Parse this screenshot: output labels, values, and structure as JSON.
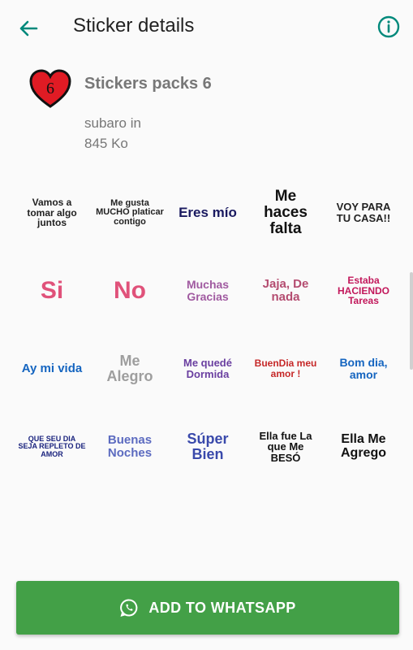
{
  "header": {
    "title": "Sticker details",
    "back_icon": "arrow-back-icon",
    "info_icon": "info-icon",
    "accent_color": "#00897b"
  },
  "pack": {
    "name": "Stickers packs 6",
    "author": "subaro in",
    "size": "845 Ko",
    "icon": "heart-number-icon",
    "icon_number": "6"
  },
  "stickers": [
    {
      "text": "Vamos a tomar algo juntos",
      "color": "#222222",
      "size": 12
    },
    {
      "text": "Me gusta MUCHO platicar contigo",
      "color": "#222222",
      "size": 11
    },
    {
      "text": "Eres mío",
      "color": "#1a1a60",
      "size": 17
    },
    {
      "text": "Me haces falta",
      "color": "#111111",
      "size": 19
    },
    {
      "text": "VOY PARA TU CASA!!",
      "color": "#222222",
      "size": 13
    },
    {
      "text": "Si",
      "color": "#e0527a",
      "size": 30
    },
    {
      "text": "No",
      "color": "#e0527a",
      "size": 30
    },
    {
      "text": "Muchas Gracias",
      "color": "#a05aa0",
      "size": 14
    },
    {
      "text": "Jaja, De nada",
      "color": "#b44c70",
      "size": 15
    },
    {
      "text": "Estaba HACIENDO Tareas",
      "color": "#c2185b",
      "size": 12
    },
    {
      "text": "Ay mi vida",
      "color": "#1565c0",
      "size": 15
    },
    {
      "text": "Me Alegro",
      "color": "#9e9e9e",
      "size": 18
    },
    {
      "text": "Me quedé Dormida",
      "color": "#6a3fa0",
      "size": 13
    },
    {
      "text": "BuenDia meu amor !",
      "color": "#c62828",
      "size": 12
    },
    {
      "text": "Bom dia, amor",
      "color": "#1565c0",
      "size": 14
    },
    {
      "text": "QUE SEU DIA SEJA REPLETO DE AMOR",
      "color": "#1a237e",
      "size": 9
    },
    {
      "text": "Buenas Noches",
      "color": "#5c6bc0",
      "size": 15
    },
    {
      "text": "Súper Bien",
      "color": "#3949ab",
      "size": 18
    },
    {
      "text": "Ella fue La que Me BESÓ",
      "color": "#111111",
      "size": 13
    },
    {
      "text": "Ella Me Agrego",
      "color": "#111111",
      "size": 16
    }
  ],
  "action": {
    "label": "ADD TO WHATSAPP",
    "icon": "whatsapp-icon",
    "button_color": "#43a047"
  }
}
